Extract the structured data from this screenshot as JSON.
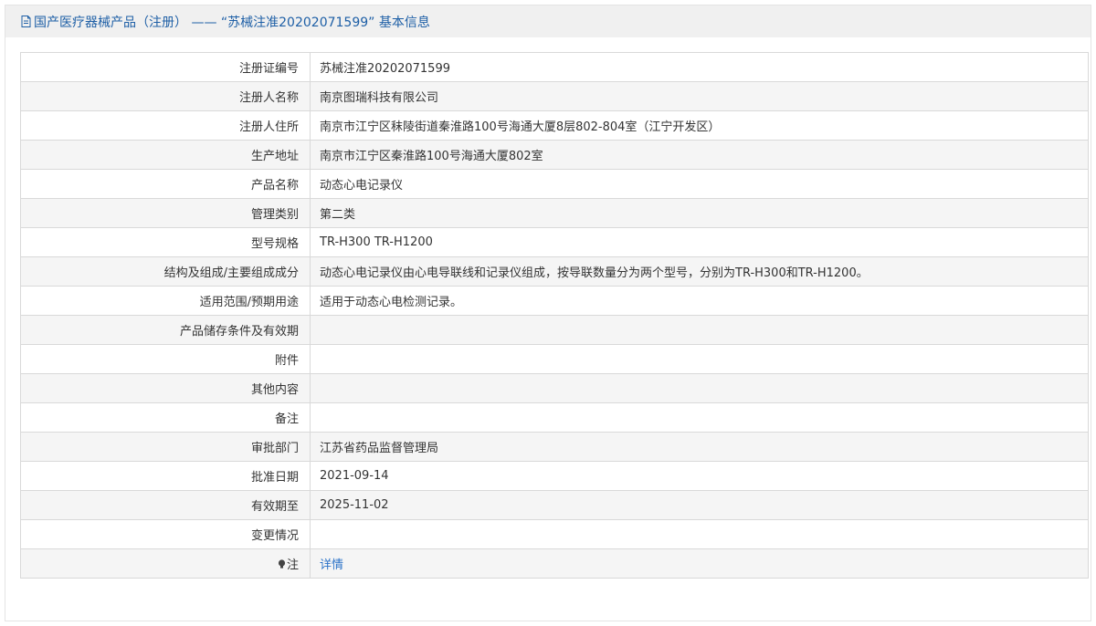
{
  "title": "国产医疗器械产品（注册） —— “苏械注准20202071599” 基本信息",
  "rows": [
    {
      "label": "注册证编号",
      "value": "苏械注准20202071599"
    },
    {
      "label": "注册人名称",
      "value": "南京图瑞科技有限公司"
    },
    {
      "label": "注册人住所",
      "value": "南京市江宁区秣陵街道秦淮路100号海通大厦8层802-804室（江宁开发区）"
    },
    {
      "label": "生产地址",
      "value": "南京市江宁区秦淮路100号海通大厦802室"
    },
    {
      "label": "产品名称",
      "value": "动态心电记录仪"
    },
    {
      "label": "管理类别",
      "value": "第二类"
    },
    {
      "label": "型号规格",
      "value": "TR-H300 TR-H1200"
    },
    {
      "label": "结构及组成/主要组成成分",
      "value": "动态心电记录仪由心电导联线和记录仪组成，按导联数量分为两个型号，分别为TR-H300和TR-H1200。"
    },
    {
      "label": "适用范围/预期用途",
      "value": "适用于动态心电检测记录。"
    },
    {
      "label": "产品储存条件及有效期",
      "value": ""
    },
    {
      "label": "附件",
      "value": ""
    },
    {
      "label": "其他内容",
      "value": ""
    },
    {
      "label": "备注",
      "value": ""
    },
    {
      "label": "审批部门",
      "value": "江苏省药品监督管理局"
    },
    {
      "label": "批准日期",
      "value": "2021-09-14"
    },
    {
      "label": "有效期至",
      "value": "2025-11-02"
    },
    {
      "label": "变更情况",
      "value": ""
    }
  ],
  "note": {
    "label": "注",
    "link_text": "详情",
    "icon": "lightbulb-icon"
  },
  "colors": {
    "title": "#1e5fa6",
    "link": "#2a72c8",
    "border": "#d9d9d9",
    "stripe": "#f5f5f5"
  }
}
